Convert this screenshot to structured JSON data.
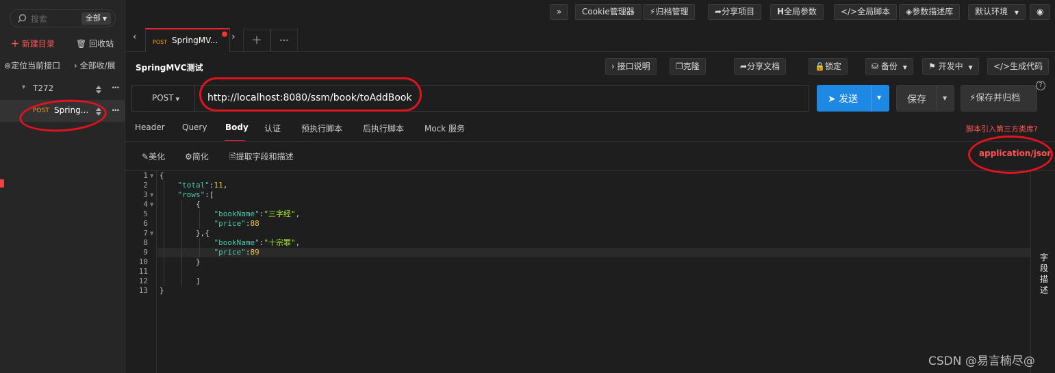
{
  "sidebar": {
    "search_placeholder": "搜索",
    "scope_label": "全部",
    "new_folder": "新建目录",
    "recycle_bin": "回收站",
    "locate_current": "定位当前接口",
    "collapse_all": "全部收/展",
    "folder_name": "T272",
    "item_method": "POST",
    "item_name": "Spring..."
  },
  "topbar": {
    "expand": "»",
    "cookie_manager": "Cookie管理器",
    "archive_manager": "归档管理",
    "share_project": "分享项目",
    "global_params": "全局参数",
    "global_script": "全局脚本",
    "param_library": "参数描述库",
    "environment": "默认环境"
  },
  "tabs": {
    "active_method": "POST",
    "active_name": "SpringMV...",
    "add": "+",
    "more": "···"
  },
  "request": {
    "title": "SpringMVC测试",
    "actions": {
      "doc": "接口说明",
      "clone": "克隆",
      "share_doc": "分享文档",
      "lock": "锁定",
      "backup": "备份",
      "status": "开发中",
      "gen_code": "生成代码"
    },
    "method": "POST",
    "url": "http://localhost:8080/ssm/book/toAddBook",
    "send": "发送",
    "save": "保存",
    "save_archive": "保存并归档",
    "help": "?"
  },
  "subtabs": [
    "Header",
    "Query",
    "Body",
    "认证",
    "预执行脚本",
    "后执行脚本",
    "Mock 服务"
  ],
  "script_link": "脚本引入第三方类库?",
  "body_tools": {
    "beautify": "美化",
    "simplify": "简化",
    "extract": "提取字段和描述",
    "content_type": "application/json"
  },
  "editor": {
    "line_numbers": [
      "1",
      "2",
      "3",
      "4",
      "5",
      "6",
      "7",
      "8",
      "9",
      "10",
      "11",
      "12",
      "13"
    ],
    "code": {
      "l1": "{",
      "l2_key": "\"total\"",
      "l2_val": "11",
      "l3_key": "\"rows\"",
      "l4": "{",
      "l5_key": "\"bookName\"",
      "l5_val": "\"三字经\"",
      "l6_key": "\"price\"",
      "l6_val": "88",
      "l7": "},{",
      "l8_key": "\"bookName\"",
      "l8_val": "\"十宗罪\"",
      "l9_key": "\"price\"",
      "l9_val": "89",
      "l11": "]",
      "l13": "}"
    }
  },
  "side_panel_label": "字段描述",
  "watermark": "CSDN @易言楠尽@"
}
